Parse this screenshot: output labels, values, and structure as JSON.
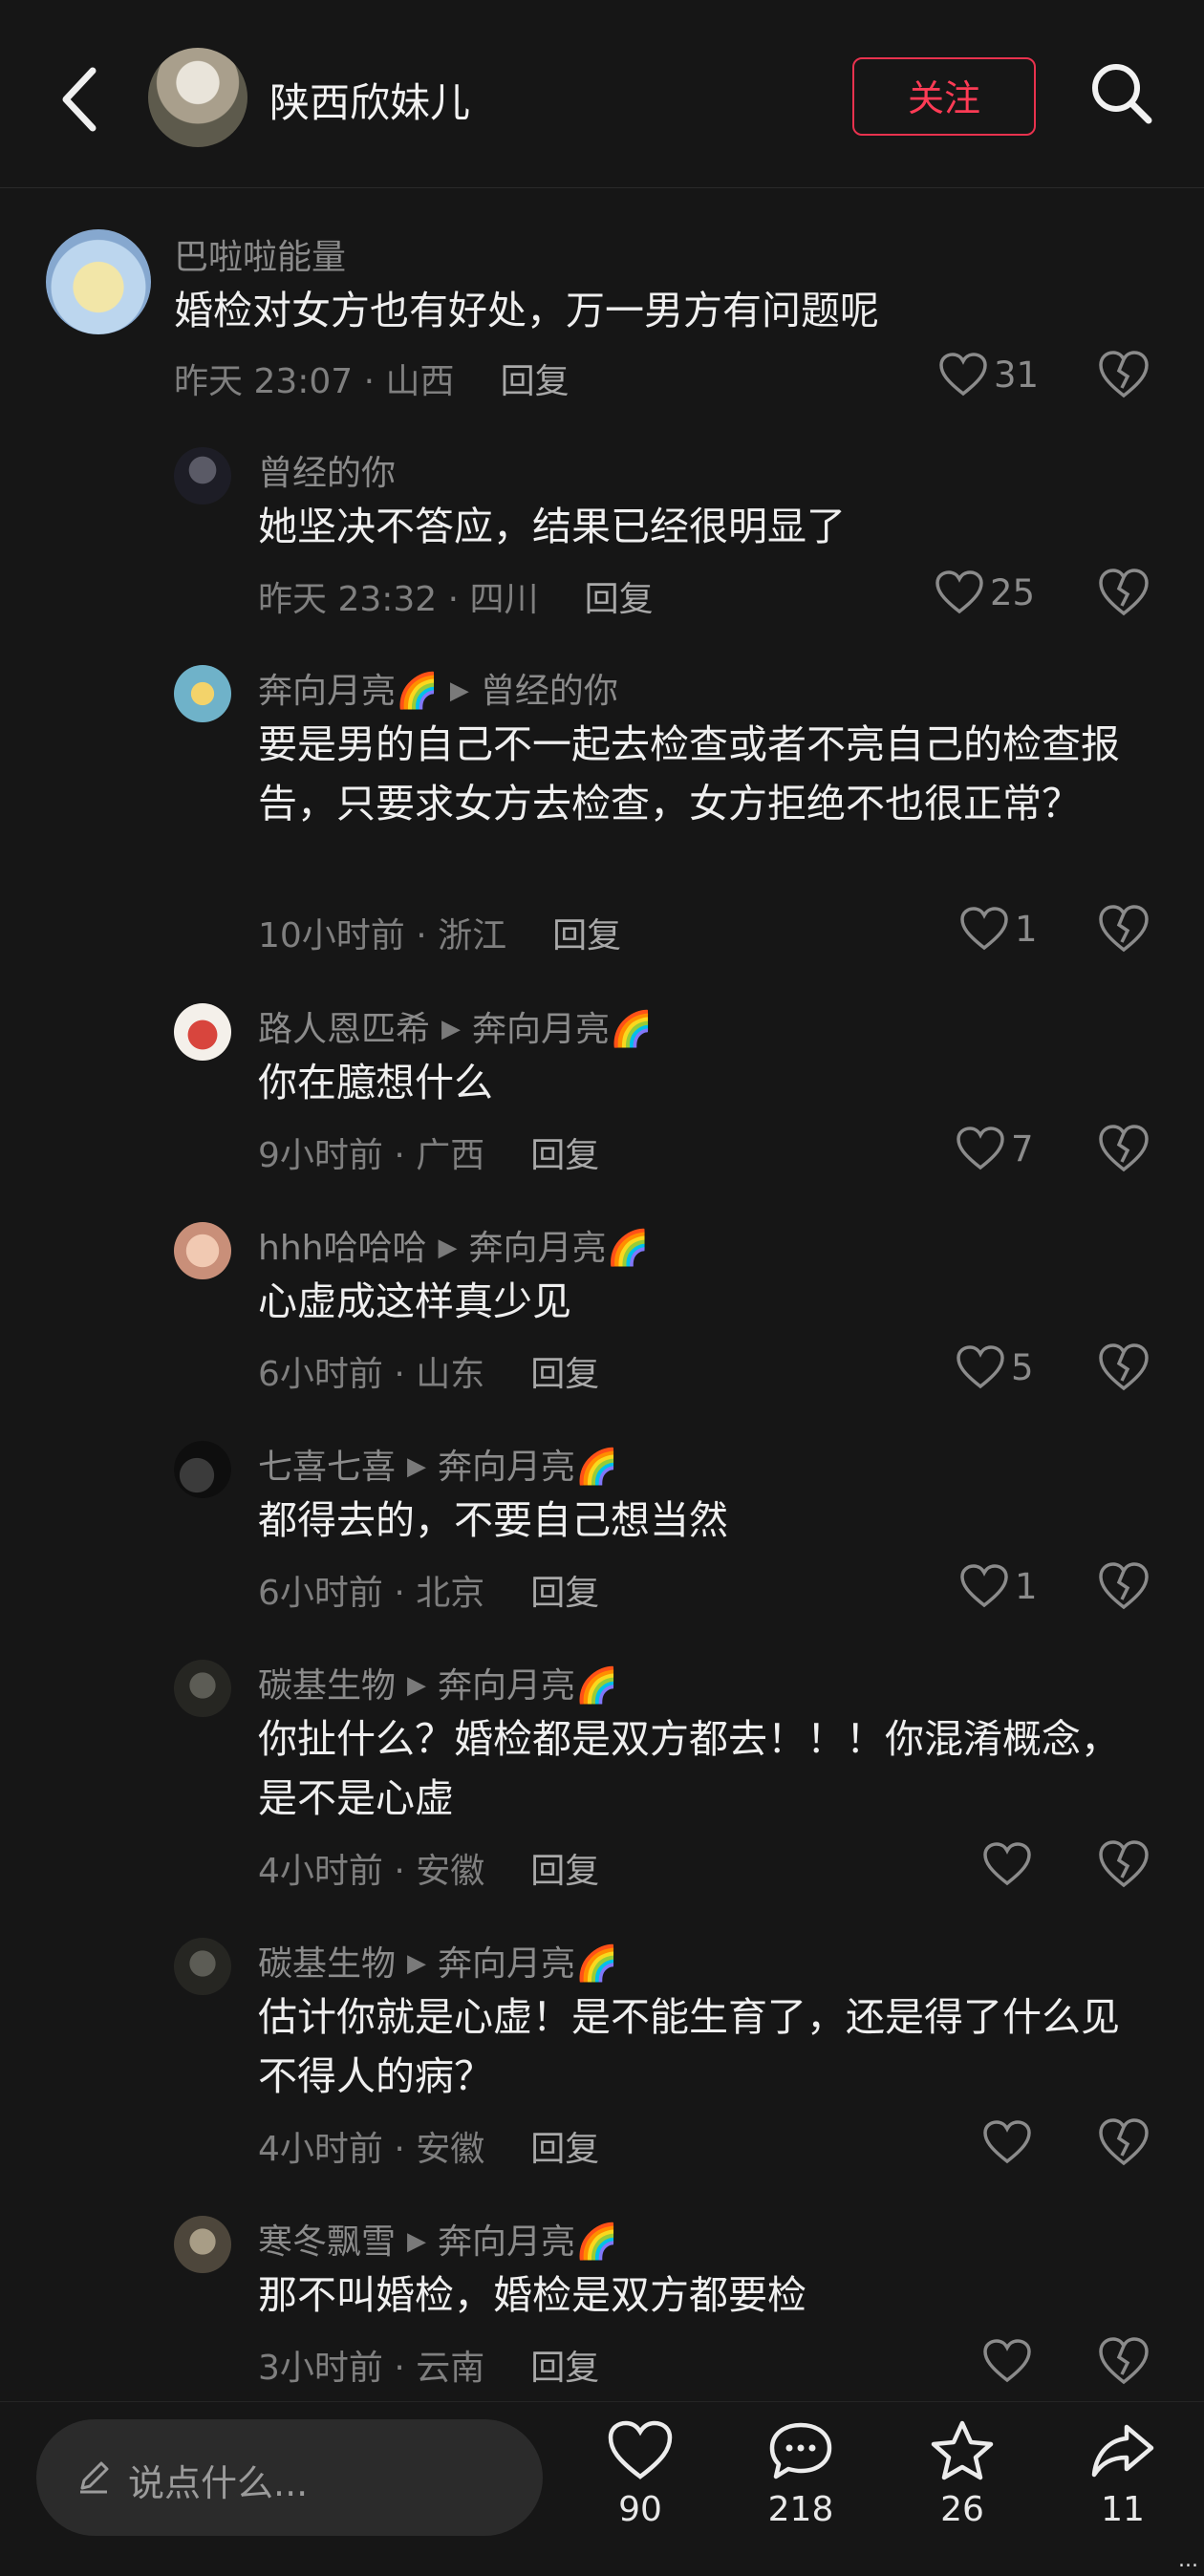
{
  "header": {
    "title": "陕西欣妹儿",
    "follow_label": "关注"
  },
  "comments": [
    {
      "user": "巴啦啦能量",
      "reply_to": "",
      "text": "婚检对女方也有好处，万一男方有问题呢",
      "time": "昨天 23:07",
      "location": "山西",
      "reply_label": "回复",
      "likes": "31"
    },
    {
      "user": "曾经的你",
      "reply_to": "",
      "text": "她坚决不答应，结果已经很明显了",
      "time": "昨天 23:32",
      "location": "四川",
      "reply_label": "回复",
      "likes": "25"
    },
    {
      "user": "奔向月亮🌈",
      "reply_to": "曾经的你",
      "text": "要是男的自己不一起去检查或者不亮自己的检查报告，只要求女方去检查，女方拒绝不也很正常？",
      "time": "10小时前",
      "location": "浙江",
      "reply_label": "回复",
      "likes": "1"
    },
    {
      "user": "路人恩匹希",
      "reply_to": "奔向月亮🌈",
      "text": "你在臆想什么",
      "time": "9小时前",
      "location": "广西",
      "reply_label": "回复",
      "likes": "7"
    },
    {
      "user": "hhh哈哈哈",
      "reply_to": "奔向月亮🌈",
      "text": "心虚成这样真少见",
      "time": "6小时前",
      "location": "山东",
      "reply_label": "回复",
      "likes": "5"
    },
    {
      "user": "七喜七喜",
      "reply_to": "奔向月亮🌈",
      "text": "都得去的，不要自己想当然",
      "time": "6小时前",
      "location": "北京",
      "reply_label": "回复",
      "likes": "1"
    },
    {
      "user": "碳基生物",
      "reply_to": "奔向月亮🌈",
      "text": "你扯什么？婚检都是双方都去！！！你混淆概念，是不是心虚",
      "time": "4小时前",
      "location": "安徽",
      "reply_label": "回复",
      "likes": ""
    },
    {
      "user": "碳基生物",
      "reply_to": "奔向月亮🌈",
      "text": "估计你就是心虚！是不能生育了，还是得了什么见不得人的病？",
      "time": "4小时前",
      "location": "安徽",
      "reply_label": "回复",
      "likes": ""
    },
    {
      "user": "寒冬飘雪",
      "reply_to": "奔向月亮🌈",
      "text": "那不叫婚检，婚检是双方都要检",
      "time": "3小时前",
      "location": "云南",
      "reply_label": "回复",
      "likes": ""
    }
  ],
  "bottom": {
    "input_placeholder": "说点什么...",
    "like_count": "90",
    "comment_count": "218",
    "star_count": "26",
    "share_count": "11"
  },
  "watermark": "...",
  "colors": {
    "background": "#161616",
    "accent": "#ff3b55",
    "text": "#efefef",
    "muted": "#8b8b8b"
  }
}
